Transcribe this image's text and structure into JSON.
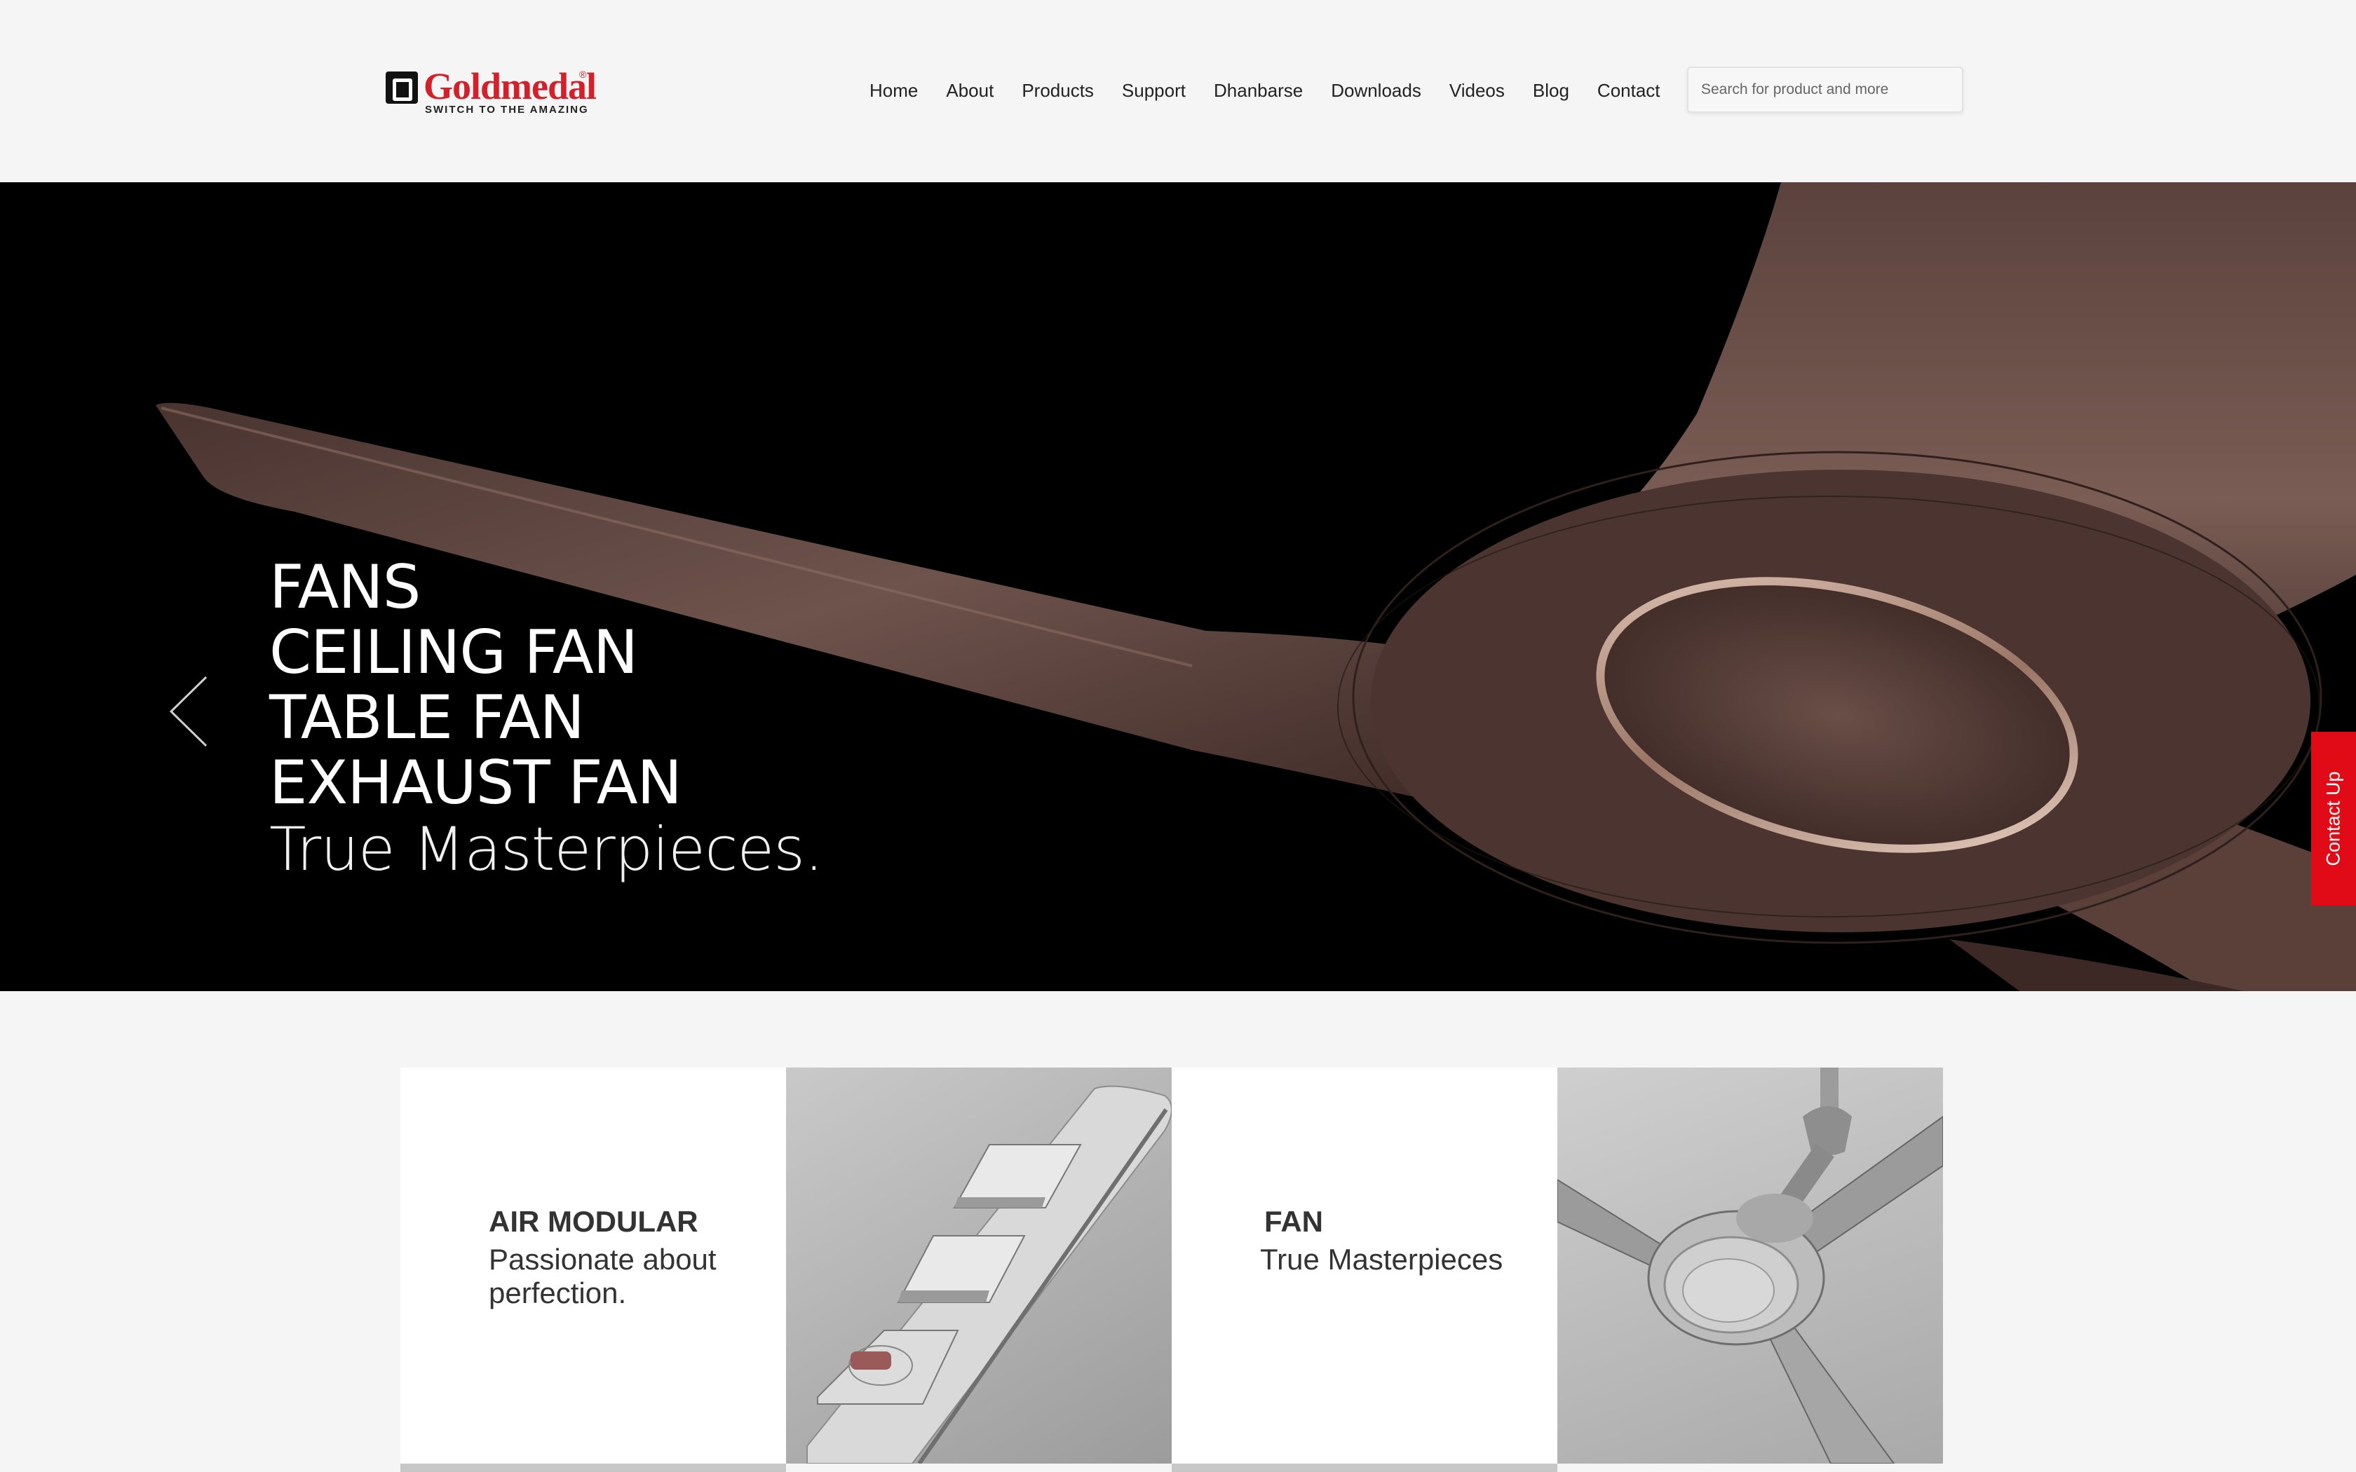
{
  "brand": {
    "name": "Goldmedal",
    "registered": "®",
    "tagline": "SWITCH TO THE AMAZING",
    "color": "#d3202a"
  },
  "nav": {
    "items": [
      "Home",
      "About",
      "Products",
      "Support",
      "Dhanbarse",
      "Downloads",
      "Videos",
      "Blog",
      "Contact"
    ]
  },
  "search": {
    "placeholder": "Search for product and more",
    "value": ""
  },
  "hero": {
    "lines": [
      "FANS",
      "CEILING FAN",
      "TABLE FAN",
      "EXHAUST FAN"
    ],
    "subtitle": "True Masterpieces.",
    "prev_icon": "chevron-left-icon",
    "image": "wooden-ceiling-fan-blades"
  },
  "contact_tab": {
    "label": "Contact Up",
    "color": "#e10b17"
  },
  "tiles": [
    {
      "title": "AIR MODULAR",
      "subtitle": "Passionate about perfection.",
      "image": "modular-switch-plate"
    },
    {
      "title": "FAN",
      "subtitle": "True Masterpieces",
      "image": "silver-ceiling-fan"
    }
  ]
}
